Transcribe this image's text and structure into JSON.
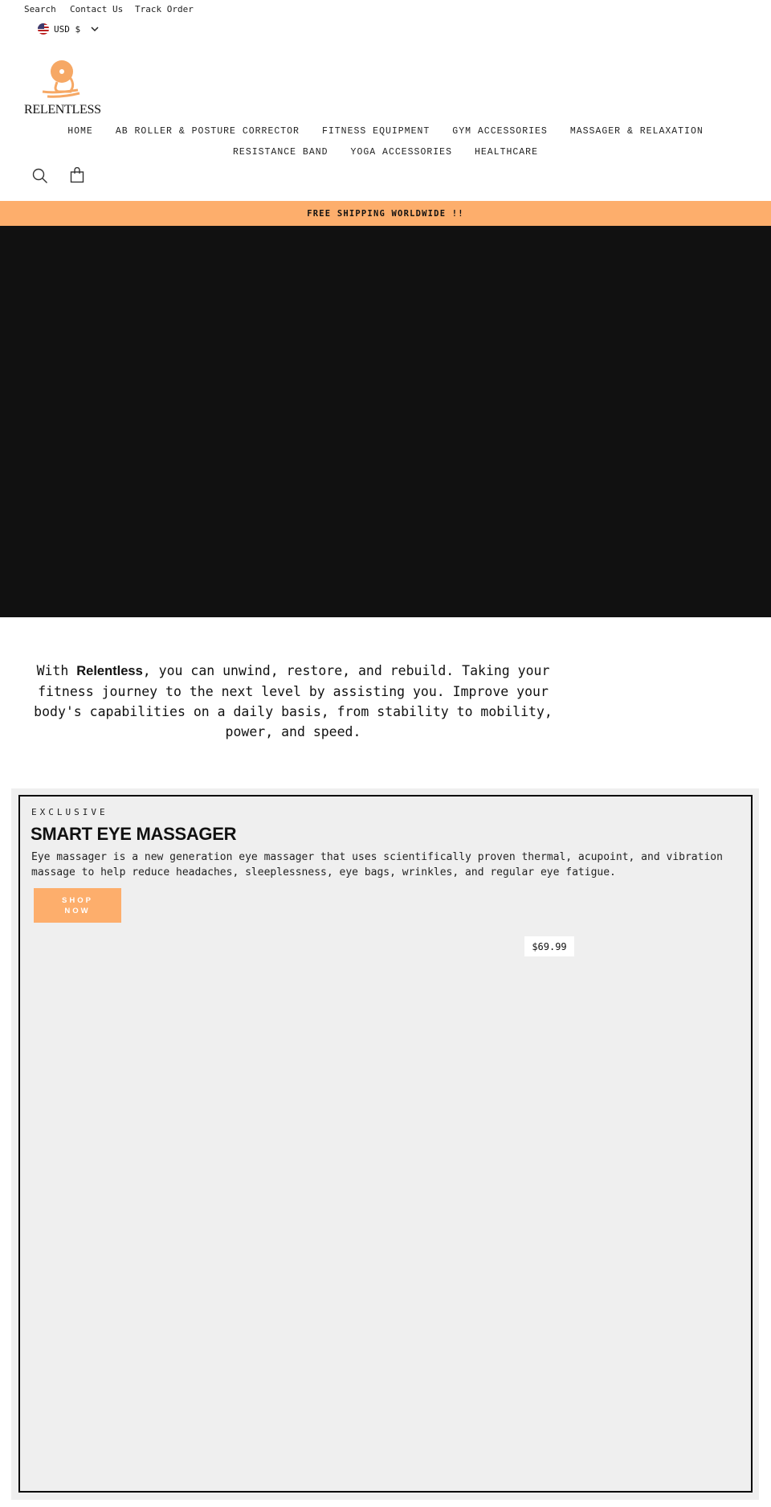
{
  "topbar": {
    "links": [
      "Search",
      "Contact Us",
      "Track Order"
    ],
    "currency": "USD $"
  },
  "logo": {
    "text": "RELENTLESS"
  },
  "nav": {
    "row1": [
      "HOME",
      "AB ROLLER & POSTURE CORRECTOR",
      "FITNESS EQUIPMENT",
      "GYM ACCESSORIES",
      "MASSAGER & RELAXATION"
    ],
    "row2": [
      "RESISTANCE BAND",
      "YOGA ACCESSORIES",
      "HEALTHCARE"
    ]
  },
  "icons": {
    "search": "search-icon",
    "cart": "cart-icon"
  },
  "banner": {
    "text": "FREE SHIPPING WORLDWIDE !!",
    "color": "#fdae6c"
  },
  "intro": {
    "prefix": "With ",
    "brand": "Relentless",
    "rest": ", you can unwind, restore, and rebuild. Taking your fitness journey to the next level by assisting you. Improve your body's capabilities on a daily basis, from stability to mobility, power, and speed."
  },
  "feature": {
    "eyebrow": "EXCLUSIVE",
    "title": "SMART EYE MASSAGER",
    "description": "Eye massager is a new generation eye massager that uses scientifically proven thermal, acupoint, and vibration massage to help reduce headaches, sleeplessness, eye bags, wrinkles, and regular eye fatigue.",
    "button": "SHOP NOW",
    "price": "$69.99"
  }
}
